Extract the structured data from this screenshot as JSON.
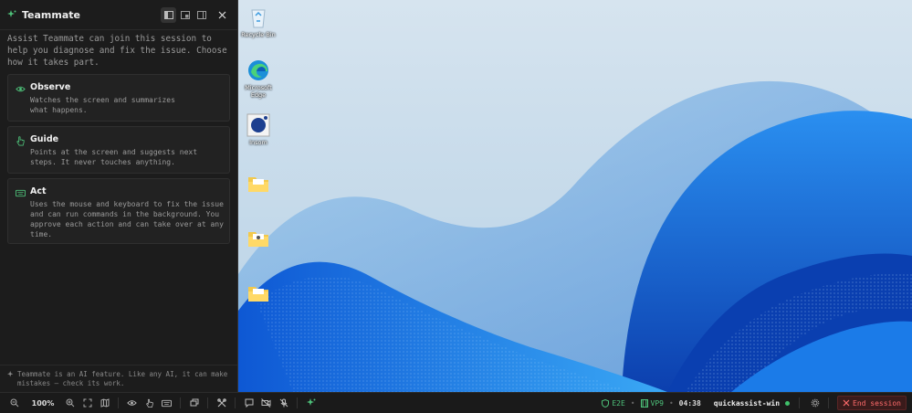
{
  "panel": {
    "title": "Teammate",
    "intro": "Assist Teammate can join this session to help you diagnose and fix the issue. Choose how it takes part.",
    "modes": [
      {
        "title": "Observe",
        "desc": "Watches the screen and summarizes what happens.",
        "icon": "eye-icon"
      },
      {
        "title": "Guide",
        "desc": "Points at the screen and suggests next steps. It never touches anything.",
        "icon": "hand-pointer-icon"
      },
      {
        "title": "Act",
        "desc": "Uses the mouse and keyboard to fix the issue and can run commands in the background. You approve each action and can take over at any time.",
        "icon": "keyboard-icon"
      }
    ],
    "footer": "Teammate is an AI feature. Like any AI, it can make mistakes — check its work."
  },
  "desktop": {
    "icons": [
      {
        "label": "Recycle Bin",
        "icon": "recycle-bin-icon"
      },
      {
        "label": "Microsoft Edge",
        "icon": "edge-icon"
      },
      {
        "label": "Insom",
        "icon": "app-shortcut-icon"
      },
      {
        "label": "",
        "icon": "folder-icon"
      },
      {
        "label": "",
        "icon": "folder-icon"
      },
      {
        "label": "",
        "icon": "folder-icon"
      }
    ]
  },
  "toolbar": {
    "zoom": "100%",
    "e2e": "E2E",
    "vp": "VP9",
    "timer": "04:38",
    "session": "quickassist-win",
    "end_label": "End session"
  },
  "colors": {
    "accent_green": "#4ec27a",
    "end_red": "#ff6b6b",
    "panel_bg": "#1c1c1c"
  }
}
